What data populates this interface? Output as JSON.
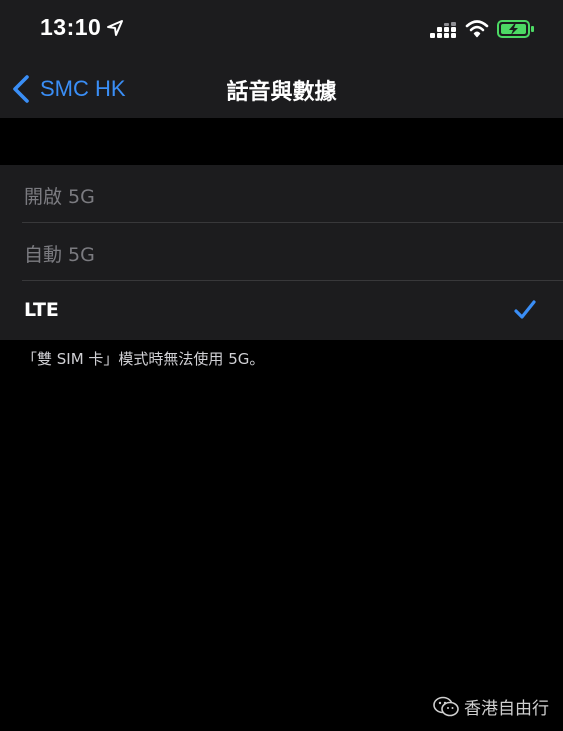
{
  "status_bar": {
    "time": "13:10",
    "location_icon": "location-arrow-icon",
    "signal_icon": "cellular-signal-icon",
    "wifi_icon": "wifi-icon",
    "battery_icon": "battery-charging-icon",
    "battery_color": "#4cd964"
  },
  "nav": {
    "back_label": "SMC HK",
    "back_icon": "chevron-left-icon",
    "title": "話音與數據",
    "accent_color": "#3a8ef6"
  },
  "options": [
    {
      "label": "開啟 5G",
      "enabled": false,
      "selected": false
    },
    {
      "label": "自動 5G",
      "enabled": false,
      "selected": false
    },
    {
      "label": "LTE",
      "enabled": true,
      "selected": true
    }
  ],
  "footer_note": "「雙 SIM 卡」模式時無法使用 5G。",
  "watermark": {
    "text": "香港自由行",
    "icon": "wechat-icon"
  }
}
